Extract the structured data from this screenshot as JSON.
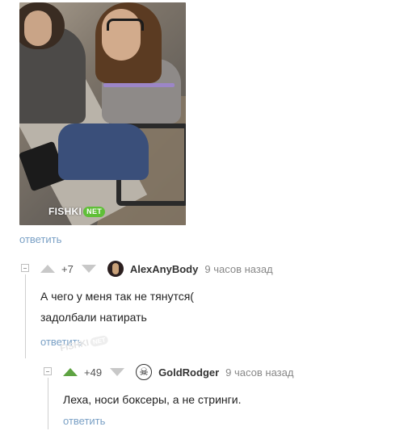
{
  "post": {
    "watermark_brand": "FISHKI",
    "watermark_suffix": "NET",
    "reply_label": "ответить"
  },
  "comments": [
    {
      "score": "+7",
      "username": "AlexAnyBody",
      "time": "9 часов назад",
      "avatar_icon": "user-avatar-dark",
      "lines": [
        "А чего у меня так не тянутся(",
        "задолбали натирать"
      ],
      "reply_label": "ответить"
    },
    {
      "score": "+49",
      "username": "GoldRodger",
      "time": "9 часов назад",
      "avatar_icon": "pirate-skull-avatar",
      "vote_up_color": "#5ea342",
      "lines": [
        "Леха, носи боксеры, а не стринги."
      ],
      "reply_label": "ответить"
    }
  ],
  "colors": {
    "link": "#7aa0c5",
    "upvote_active": "#5ea342",
    "vote_inactive": "#c8c8c8"
  }
}
